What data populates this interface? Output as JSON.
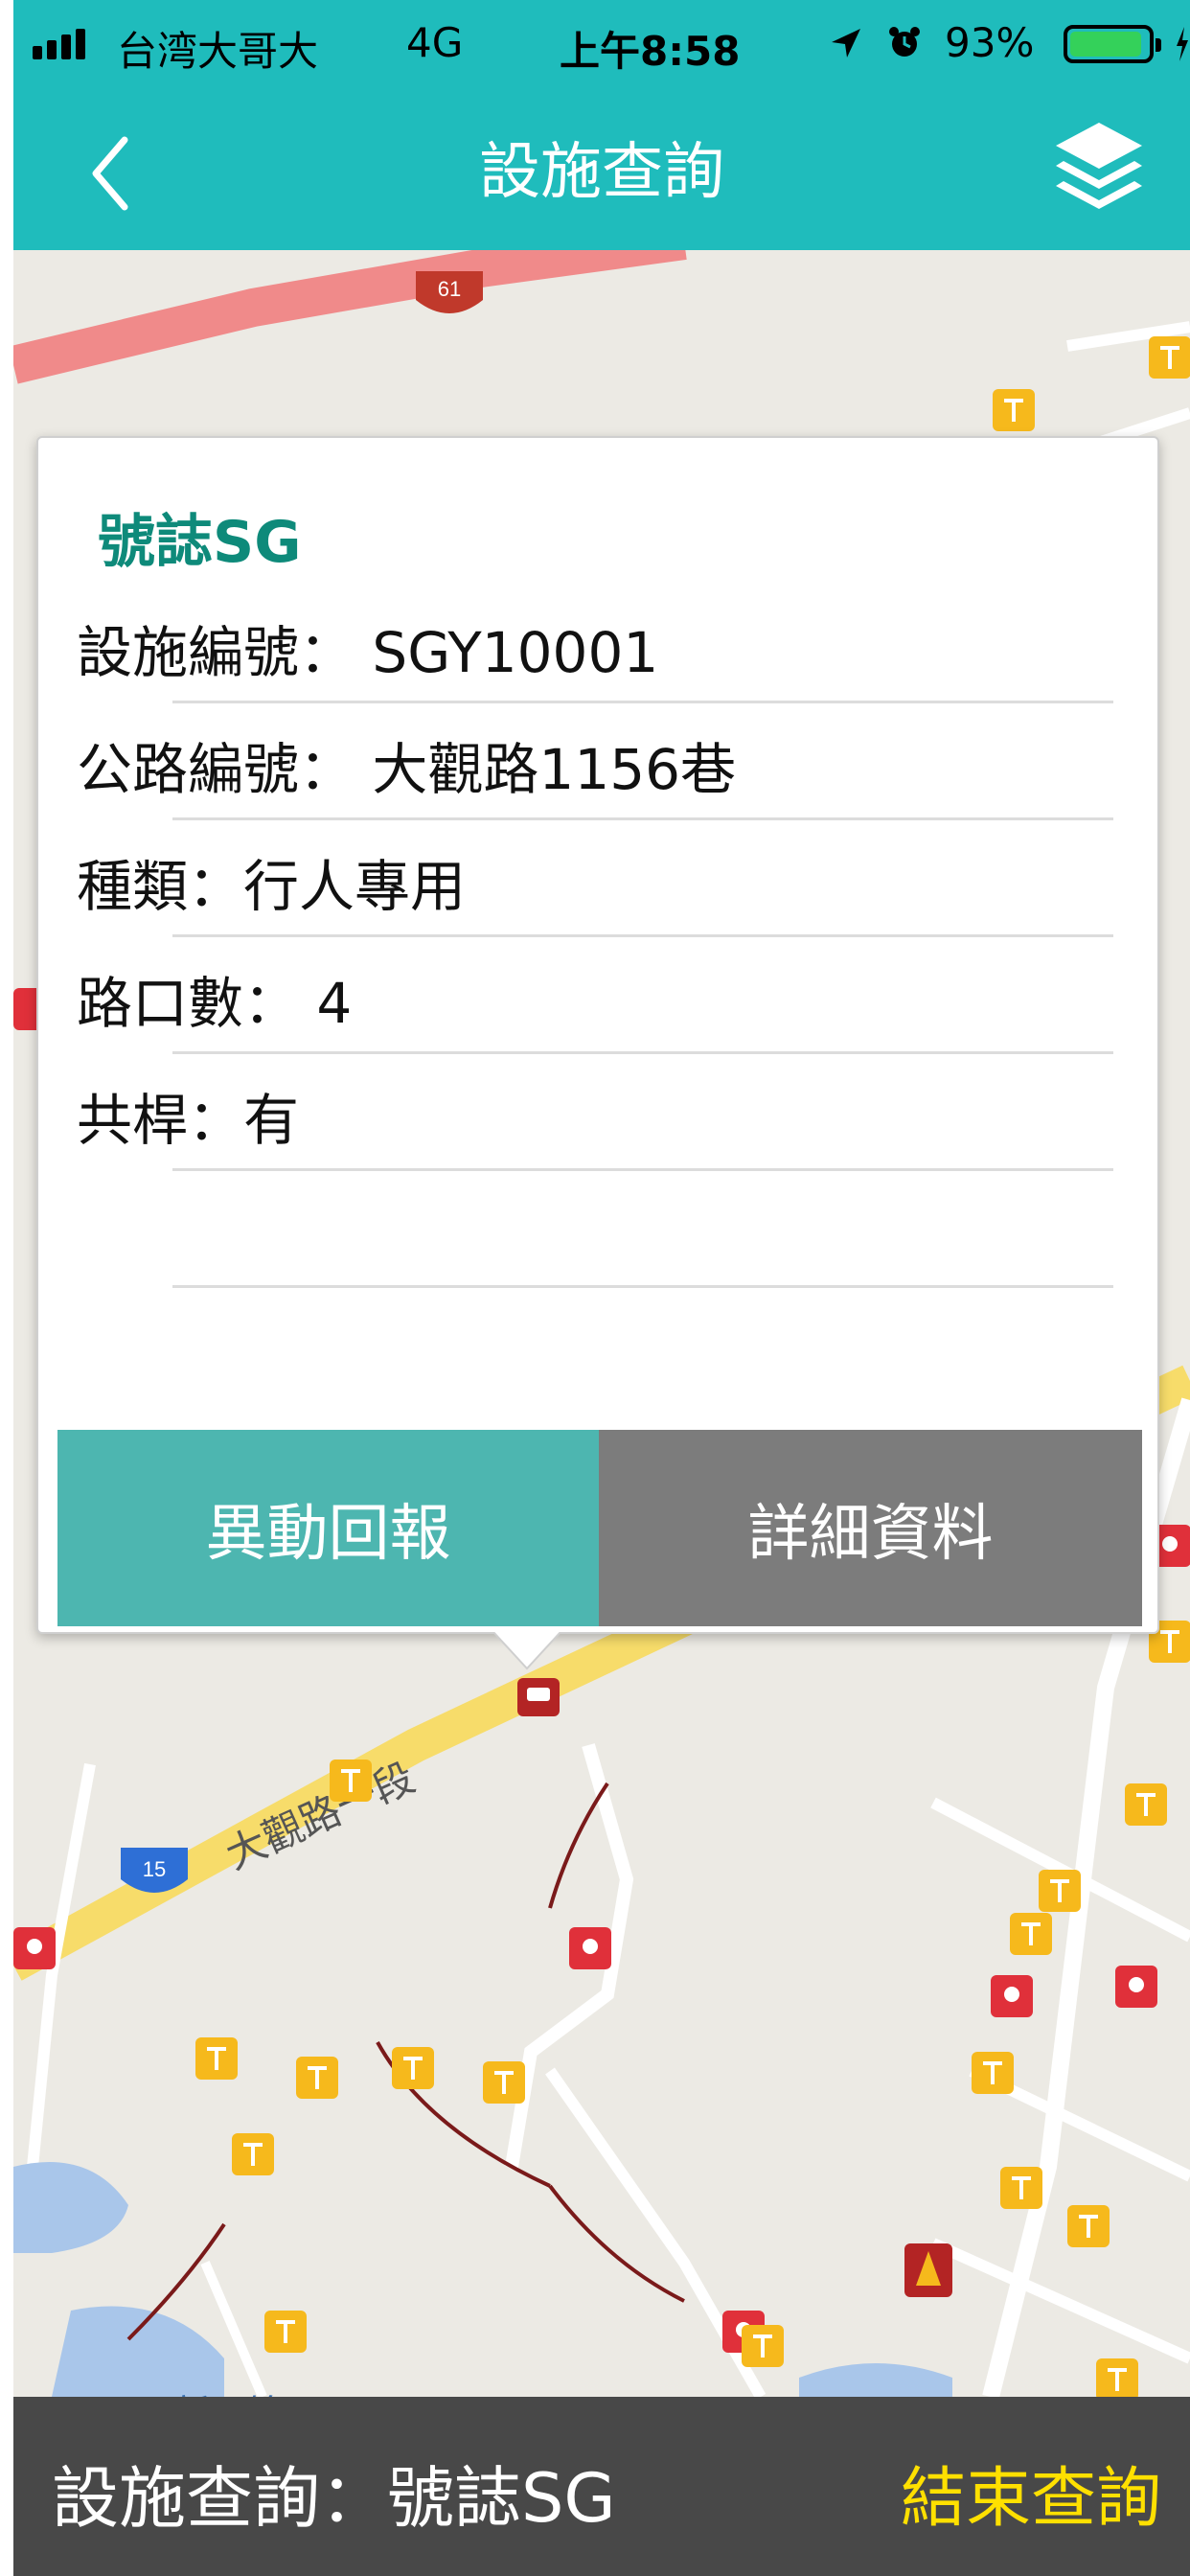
{
  "status_bar": {
    "carrier": "台湾大哥大",
    "network": "4G",
    "time": "上午8:58",
    "battery": "93%",
    "battery_level": 0.93
  },
  "nav": {
    "title": "設施查詢",
    "back_icon": "chevron-left-icon",
    "layers_icon": "layers-icon"
  },
  "map": {
    "road_labels": [
      "61",
      "15",
      "大觀路一段"
    ],
    "place_labels": [
      "新厝埤"
    ],
    "marker_icons": [
      "signal-marker-icon",
      "traffic-light-marker-icon",
      "cone-marker-icon"
    ]
  },
  "popup": {
    "heading": "號誌SG",
    "rows": [
      "設施編號： SGY10001",
      "公路編號： 大觀路1156巷",
      "種類：行人專用",
      "路口數： 4",
      "共桿：有",
      ""
    ],
    "report_button": "異動回報",
    "detail_button": "詳細資料"
  },
  "bottom_bar": {
    "label": "設施查詢：號誌SG",
    "end_button": "結束查詢"
  },
  "colors": {
    "header": "#1fbcbc",
    "heading_text": "#0e8a7a",
    "report_button": "#4db6b0",
    "detail_button": "#7c7c7c",
    "end_query": "#ffe000"
  }
}
